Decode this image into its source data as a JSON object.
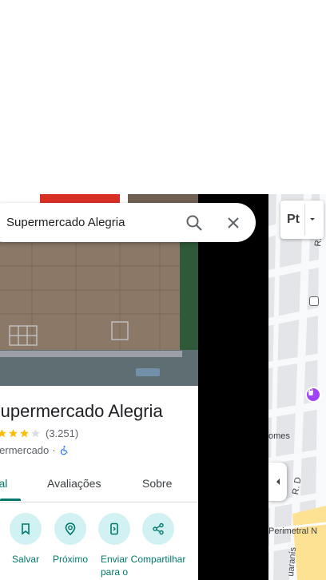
{
  "search": {
    "value": "Supermercado Alegria"
  },
  "place": {
    "title": "Supermercado Alegria",
    "rating_stars": 3,
    "reviews": "(3.251)",
    "category": "Supermercado",
    "accessibility": "wheelchair-accessible-icon"
  },
  "tabs": [
    {
      "label": "Visão geral",
      "visible": "eral",
      "active": true
    },
    {
      "label": "Avaliações"
    },
    {
      "label": "Sobre"
    }
  ],
  "actions": [
    {
      "label": "Salvar",
      "icon": "bookmark-icon"
    },
    {
      "label": "Próximo",
      "icon": "nearby-icon"
    },
    {
      "label": "Enviar para o smartphone",
      "visible": "Enviar para o",
      "icon": "send-to-phone-icon"
    },
    {
      "label": "Compartilhar",
      "visible": "Compartilhar",
      "icon": "share-icon"
    }
  ],
  "map": {
    "layer_code": "Pt",
    "labels": {
      "street_d1": "R. D",
      "street_d2": "R. D",
      "area": "omes",
      "perimetral": "Perimetral N",
      "guaranis": "uaranís"
    }
  },
  "colors": {
    "accent": "#00796b",
    "action_bg": "#d2f1f3",
    "star": "#fbbc04",
    "mall_pin": "#a142f4"
  }
}
